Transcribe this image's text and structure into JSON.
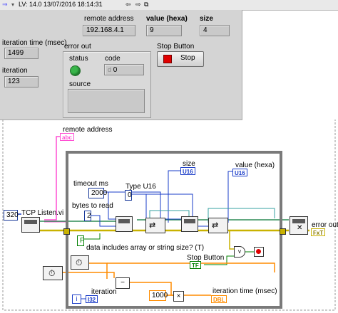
{
  "toolbar": {
    "title": "LV: 14.0 13/07/2016 18:14:31"
  },
  "front_panel": {
    "remote_address": {
      "label": "remote address",
      "value": "192.168.4.1"
    },
    "value_hexa": {
      "label": "value (hexa)",
      "value": "9"
    },
    "size": {
      "label": "size",
      "value": "4"
    },
    "iteration_time": {
      "label": "iteration time (msec)",
      "value": "1499"
    },
    "iteration": {
      "label": "iteration",
      "value": "123"
    },
    "error_out": {
      "label": "error out",
      "status_label": "status",
      "code_label": "code",
      "code_value": "0",
      "code_prefix": "d",
      "source_label": "source",
      "status_color": "#39b54a"
    },
    "stop_button": {
      "label": "Stop Button",
      "text": "Stop",
      "indicator_color": "#e00000"
    }
  },
  "block_diagram": {
    "remote_address_label": "remote address",
    "remote_address_term": "abc",
    "port_const": "320",
    "tcp_listen_label": "TCP Listen.vi",
    "timeout_label": "timeout ms",
    "timeout_const": "2000",
    "type_label": "Type U16",
    "type_const": "0",
    "bytes_label": "bytes to read",
    "bytes_const": "2",
    "size_label": "size",
    "size_term": "U16",
    "value_label": "value (hexa)",
    "value_term": "U16",
    "bool_const": "F",
    "include_size_label": "data includes array or string size? (T)",
    "stop_label": "Stop Button",
    "stop_term": "TF",
    "iteration_label": "iteration",
    "iteration_term": "I32",
    "iter_terminal": "i",
    "ms_const": "1000",
    "iter_time_label": "iteration time (msec)",
    "iter_time_term": "DBL",
    "error_out_label": "error out",
    "error_out_term": "FxT",
    "colors": {
      "int_wire": "#1a3cc8",
      "err_wire": "#c9b200",
      "dbl_wire": "#ff8c00",
      "str_wire": "#ff4fd3",
      "ref_wire": "#2e8b57",
      "bool_wire": "#008000"
    }
  }
}
